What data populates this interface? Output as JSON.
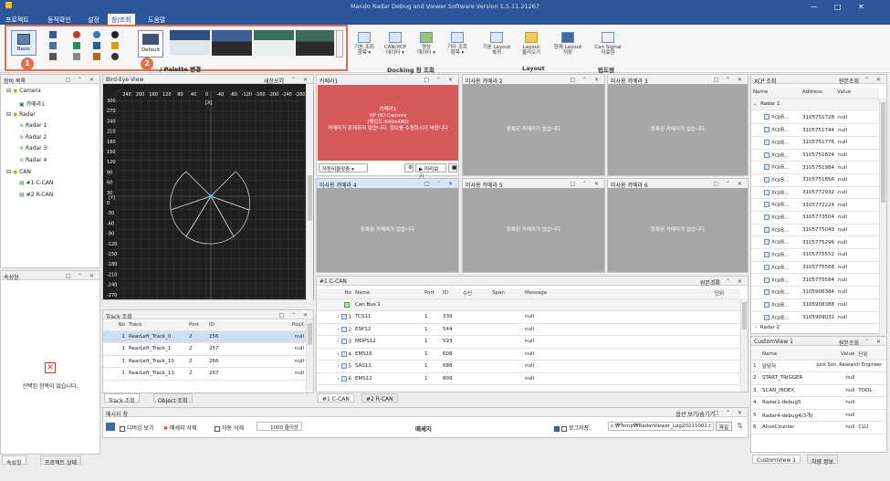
{
  "window": {
    "title": "Mando Radar Debug and Viewer Software Version 1.5.11.21267"
  },
  "menu": [
    "프로젝트",
    "동작확인",
    "설정",
    "창/조회",
    "도움말"
  ],
  "ribbon": {
    "basic_label": "Basic",
    "default_label": "Default",
    "palette_label": "/ Palette 변경",
    "view_buttons": [
      {
        "label": "기본 조회\n항목 ▾"
      },
      {
        "label": "CAN/XCP\n데이터 ▾"
      },
      {
        "label": "영상\n데이터 ▾"
      },
      {
        "label": "기타 조회\n항목 ▾"
      },
      {
        "label": "기본 Layout\n복귀"
      },
      {
        "label": "Layout\n불러오기"
      },
      {
        "label": "현재 Layout\n저장"
      },
      {
        "label": "Can Signal\n자료창"
      }
    ],
    "groups": [
      "Docking 창 조회",
      "Layout",
      "법도량"
    ]
  },
  "badges": [
    "1",
    "2"
  ],
  "equip": {
    "title": "장비 목록",
    "items": [
      {
        "label": "Camera"
      },
      {
        "label": "카메라1"
      },
      {
        "label": "Radar"
      },
      {
        "label": "Radar 1"
      },
      {
        "label": "Radar 2"
      },
      {
        "label": "Radar 3"
      },
      {
        "label": "Radar 4"
      },
      {
        "label": "CAN"
      },
      {
        "label": "#1 C-CAN"
      },
      {
        "label": "#2 R-CAN"
      }
    ]
  },
  "props": {
    "title": "속성창",
    "empty": "선택된 항목이 없습니다.",
    "tabs": [
      "속성창",
      "프로젝트 상태"
    ]
  },
  "bev": {
    "title": "Bird-Eye View",
    "new_view": "새창보기",
    "x_ticks": [
      "240",
      "200",
      "160",
      "120",
      "80",
      "40",
      "0",
      "-40",
      "-80",
      "-120",
      "-160",
      "-200",
      "-240",
      "-280"
    ],
    "y_ticks": [
      "300",
      "270",
      "240",
      "210",
      "180",
      "150",
      "120",
      "90",
      "60",
      "30",
      "0",
      "-30",
      "-60",
      "-90",
      "-120",
      "-150",
      "-180",
      "-210",
      "-240",
      "-270",
      "-300"
    ],
    "x_unit": "[X]",
    "y_unit": "[Y]"
  },
  "track": {
    "title": "Track 조회",
    "headers": [
      "No",
      "Track",
      "Port",
      "ID",
      "PosX"
    ],
    "rows": [
      [
        "1",
        "RearLeft_Track_0",
        "2",
        "256",
        "null"
      ],
      [
        "1",
        "RearLeft_Track_1",
        "2",
        "257",
        "null"
      ],
      [
        "1",
        "RearLeft_Track_10",
        "2",
        "266",
        "null"
      ],
      [
        "1",
        "RearLeft_Track_11",
        "2",
        "267",
        "null"
      ]
    ],
    "tabs": [
      "Track 조회",
      "Object 조회"
    ]
  },
  "cameras": {
    "cam1": {
      "title": "카메라1",
      "msg": "카메라1\nHP HD Camera\n(해상도:640x480)\n카메라가 존재하지 않습니다. 정보를 수정하시기 바랍니다",
      "fit": "자동비율맞춤",
      "preview": "미리보기"
    },
    "others": [
      {
        "title": "미사용 카메라 2"
      },
      {
        "title": "미사용 카메라 3"
      },
      {
        "title": "미사용 카메라 4"
      },
      {
        "title": "미사용 카메라 5"
      },
      {
        "title": "미사용 카메라 6"
      }
    ],
    "none_msg": "등록된 카메라가 없습니다"
  },
  "can": {
    "title": "#1 C-CAN",
    "raw": "원본조회",
    "headers": [
      "No",
      "Name",
      "Port",
      "ID",
      "수신",
      "Span",
      "Message",
      "단위"
    ],
    "bus": "Can Bus 1",
    "rows": [
      [
        "1",
        "TCS11",
        "1",
        "339",
        "null"
      ],
      [
        "2",
        "ESP12",
        "1",
        "544",
        "null"
      ],
      [
        "3",
        "MDPS12",
        "1",
        "593",
        "null"
      ],
      [
        "4",
        "EMS16",
        "1",
        "608",
        "null"
      ],
      [
        "5",
        "SAS11",
        "1",
        "688",
        "null"
      ],
      [
        "6",
        "EMS12",
        "1",
        "809",
        "null"
      ]
    ],
    "tabs": [
      "#1 C-CAN",
      "#2 R-CAN"
    ]
  },
  "xcp": {
    "title": "XCP 조회",
    "raw": "원본조회",
    "headers": [
      "Name",
      "Address",
      "Value"
    ],
    "group1": "Radar 1",
    "group2": "Radar 2",
    "rows": [
      [
        "XcpB...",
        "3105751728",
        "null"
      ],
      [
        "XcpB...",
        "3105751744",
        "null"
      ],
      [
        "XcpB...",
        "3105751776",
        "null"
      ],
      [
        "XcpB...",
        "3105751824",
        "null"
      ],
      [
        "XcpB...",
        "3105751984",
        "null"
      ],
      [
        "XcpB...",
        "3105751856",
        "null"
      ],
      [
        "XcpB...",
        "3105772032",
        "null"
      ],
      [
        "XcpB...",
        "3105772224",
        "null"
      ],
      [
        "XcpB...",
        "3105773504",
        "null"
      ],
      [
        "XcpB...",
        "3105775040",
        "null"
      ],
      [
        "XcpB...",
        "3105775296",
        "null"
      ],
      [
        "XcpB...",
        "3105775552",
        "null"
      ],
      [
        "XcpB...",
        "3105775568",
        "null"
      ],
      [
        "XcpB...",
        "3105775584",
        "null"
      ],
      [
        "XcpB...",
        "3105908384",
        "null"
      ],
      [
        "XcpB...",
        "3105908388",
        "null"
      ],
      [
        "XcpB...",
        "3105909032",
        "null"
      ]
    ]
  },
  "custom": {
    "title": "CustomView 1",
    "raw": "원본조회",
    "headers": [
      "Name",
      "Value",
      "단위"
    ],
    "rows": [
      [
        "1",
        "담당자",
        "Junk Son, Research Engineer",
        ""
      ],
      [
        "2",
        "START_TRIGGER",
        "null",
        ""
      ],
      [
        "3",
        "SCAN_INDEX",
        "null",
        "TOOL"
      ],
      [
        "4",
        "Radar1-debug5",
        "null",
        ""
      ],
      [
        "5",
        "Radar4-debug4(3개)",
        "null",
        ""
      ],
      [
        "6",
        "AliveCounter",
        "null",
        "CLU"
      ]
    ],
    "tabs": [
      "CustomView 1",
      "차량 정보"
    ]
  },
  "msg": {
    "title": "메시지 창",
    "toggle": "옵션 보기/숨기기",
    "debug": "디버깅 보기",
    "clear": "메세지 삭제",
    "auto": "자동 삭제",
    "count": "1000 줄이상",
    "center": "메세지",
    "save": "로그저장",
    "path": "c:₩Temp₩RadarViewer_Log20211001.t",
    "file": "파일"
  }
}
